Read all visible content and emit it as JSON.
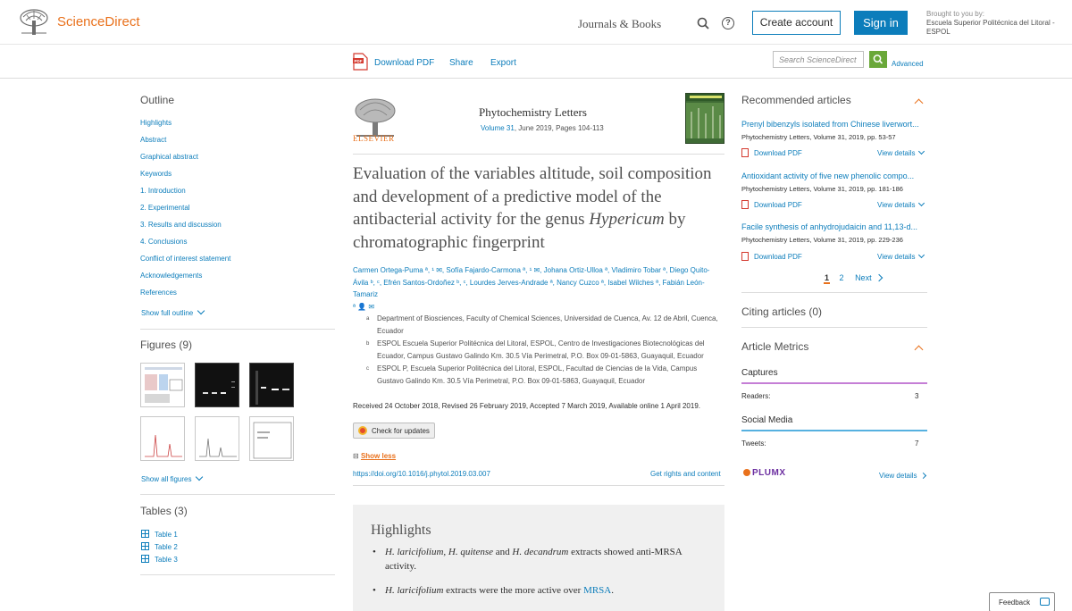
{
  "header": {
    "brand": "ScienceDirect",
    "journals_books": "Journals & Books",
    "create_account": "Create account",
    "sign_in": "Sign in",
    "brought_label": "Brought to you by:",
    "brought_institution": "Escuela Superior Politécnica del Litoral - ESPOL"
  },
  "toolbar": {
    "download_pdf": "Download PDF",
    "share": "Share",
    "export": "Export",
    "search_placeholder": "Search ScienceDirect",
    "advanced": "Advanced"
  },
  "outline": {
    "title": "Outline",
    "items": [
      "Highlights",
      "Abstract",
      "Graphical abstract",
      "Keywords",
      "1. Introduction",
      "2. Experimental",
      "3. Results and discussion",
      "4. Conclusions",
      "Conflict of interest statement",
      "Acknowledgements",
      "References"
    ],
    "show_full": "Show full outline"
  },
  "figures": {
    "title": "Figures (9)",
    "show_all": "Show all figures"
  },
  "tables": {
    "title": "Tables (3)",
    "items": [
      "Table 1",
      "Table 2",
      "Table 3"
    ]
  },
  "article": {
    "elsevier": "ELSEVIER",
    "journal": "Phytochemistry Letters",
    "volume_link": "Volume 31",
    "volume_rest": ", June 2019, Pages 104-113",
    "title_part1": "Evaluation of the variables altitude, soil composition and development of a predictive model of the antibacterial activity for the genus ",
    "title_italic": "Hypericum",
    "title_part2": " by chromatographic fingerprint",
    "authors_line1": "Carmen Ortega-Puma ª, ¹ ✉, Sofía Fajardo-Carmona ª, ¹ ✉, Johana Ortiz-Ulloa ª, Vladimiro Tobar ª, Diego Quito-",
    "authors_line2": "Ávila ᵇ, ᶜ, Efrén Santos-Ordoñez ᵇ, ᶜ, Lourdes Jerves-Andrade ª, Nancy Cuzco ª, Isabel Wilches ª, Fabián León-Tamariz",
    "authors_line3": "ª 👤 ✉",
    "affiliations": [
      {
        "sup": "a",
        "text": "Department of Biosciences, Faculty of Chemical Sciences, Universidad de Cuenca, Av. 12 de Abril, Cuenca, Ecuador"
      },
      {
        "sup": "b",
        "text": "ESPOL Escuela Superior Politécnica del Litoral, ESPOL, Centro de Investigaciones Biotecnológicas del Ecuador, Campus Gustavo Galindo Km. 30.5 Vía Perimetral, P.O. Box 09-01-5863, Guayaquil, Ecuador"
      },
      {
        "sup": "c",
        "text": "ESPOL P, Escuela Superior Politécnica del Litoral, ESPOL, Facultad de Ciencias de la Vida, Campus Gustavo Galindo Km. 30.5 Vía Perimetral, P.O. Box 09-01-5863, Guayaquil, Ecuador"
      }
    ],
    "dates": "Received 24 October 2018, Revised 26 February 2019, Accepted 7 March 2019, Available online 1 April 2019.",
    "check_updates": "Check for updates",
    "show_less": "Show less",
    "doi": "https://doi.org/10.1016/j.phytol.2019.03.007",
    "rights": "Get rights and content"
  },
  "highlights": {
    "title": "Highlights",
    "item1_pre": "H. laricifolium, H. quitense",
    "item1_mid": " and ",
    "item1_em": "H. decandrum",
    "item1_post": " extracts showed anti-MRSA activity.",
    "item2_em": "H. laricifolium",
    "item2_post": " extracts were the more active over ",
    "item2_link": "MRSA",
    "item2_end": "."
  },
  "recommended": {
    "title": "Recommended articles",
    "items": [
      {
        "title": "Prenyl bibenzyls isolated from Chinese liverwort...",
        "meta": "Phytochemistry Letters, Volume 31, 2019, pp. 53-57",
        "pdf": "Download PDF",
        "details": "View details"
      },
      {
        "title": "Antioxidant activity of five new phenolic compo...",
        "meta": "Phytochemistry Letters, Volume 31, 2019, pp. 181-186",
        "pdf": "Download PDF",
        "details": "View details"
      },
      {
        "title": "Facile synthesis of anhydrojudaicin and 11,13-d...",
        "meta": "Phytochemistry Letters, Volume 31, 2019, pp. 229-236",
        "pdf": "Download PDF",
        "details": "View details"
      }
    ],
    "page1": "1",
    "page2": "2",
    "next": "Next"
  },
  "citing": {
    "title": "Citing articles (0)"
  },
  "metrics": {
    "title": "Article Metrics",
    "captures": "Captures",
    "readers_label": "Readers:",
    "readers_val": "3",
    "social": "Social Media",
    "tweets_label": "Tweets:",
    "tweets_val": "7",
    "plumx": "PLUMX",
    "view_details": "View details"
  },
  "feedback": "Feedback",
  "colors": {
    "accent": "#0c7dbb",
    "brand": "#e9711c",
    "captures_bar": "#c57ed6",
    "social_bar": "#56b1e0"
  }
}
